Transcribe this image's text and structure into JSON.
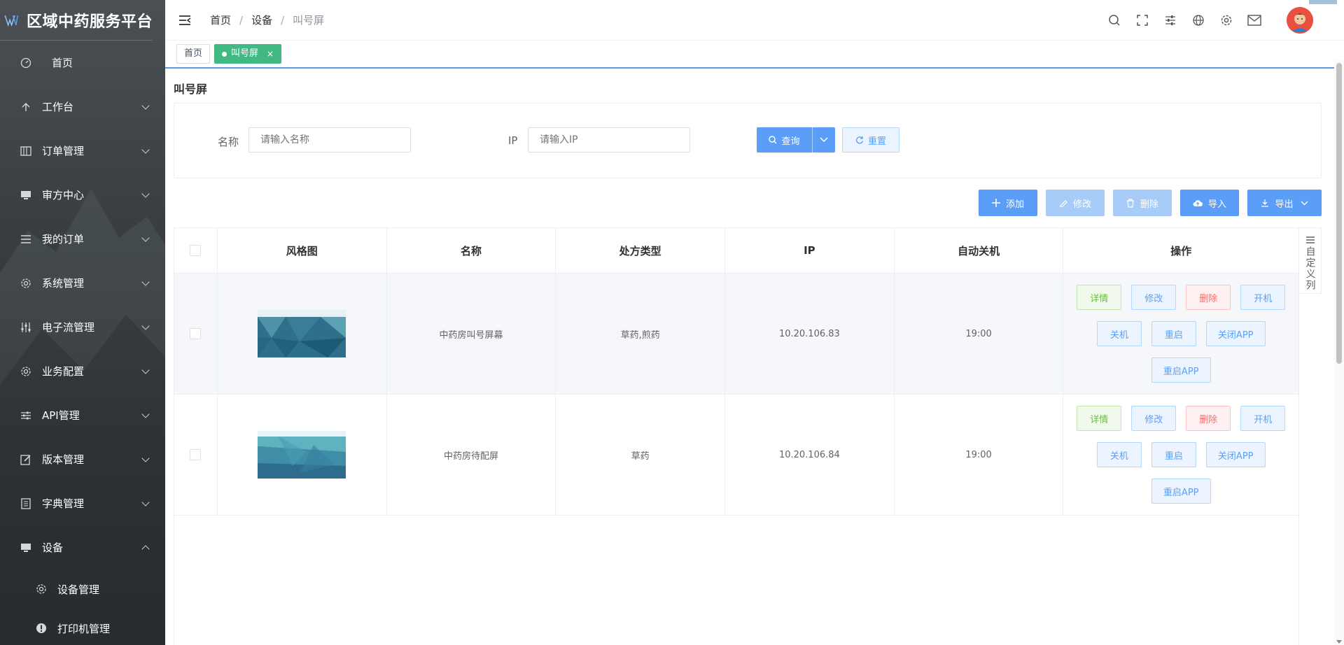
{
  "brand": {
    "title": "区域中药服务平台"
  },
  "sidebar": {
    "items": [
      {
        "label": "首页",
        "icon": "dashboard-icon",
        "has_arrow": false
      },
      {
        "label": "工作台",
        "icon": "arrow-up-icon",
        "has_arrow": true
      },
      {
        "label": "订单管理",
        "icon": "table-icon",
        "has_arrow": true
      },
      {
        "label": "审方中心",
        "icon": "monitor-icon",
        "has_arrow": true
      },
      {
        "label": "我的订单",
        "icon": "list-icon",
        "has_arrow": true
      },
      {
        "label": "系统管理",
        "icon": "gear-icon",
        "has_arrow": true
      },
      {
        "label": "电子流管理",
        "icon": "sliders-icon",
        "has_arrow": true
      },
      {
        "label": "业务配置",
        "icon": "gear-icon",
        "has_arrow": true
      },
      {
        "label": "API管理",
        "icon": "filter-icon",
        "has_arrow": true
      },
      {
        "label": "版本管理",
        "icon": "edit-icon",
        "has_arrow": true
      },
      {
        "label": "字典管理",
        "icon": "book-icon",
        "has_arrow": true
      },
      {
        "label": "设备",
        "icon": "monitor-icon",
        "has_arrow": true,
        "expanded": true
      }
    ],
    "sub_items": [
      {
        "label": "设备管理",
        "icon": "gear-icon"
      },
      {
        "label": "打印机管理",
        "icon": "info-icon"
      }
    ]
  },
  "header": {
    "breadcrumb": [
      "首页",
      "设备",
      "叫号屏"
    ],
    "sep": "/"
  },
  "tabs": [
    {
      "label": "首页",
      "active": false
    },
    {
      "label": "叫号屏",
      "active": true,
      "close": "×"
    }
  ],
  "page": {
    "title": "叫号屏"
  },
  "search": {
    "name_label": "名称",
    "name_placeholder": "请输入名称",
    "ip_label": "IP",
    "ip_placeholder": "请输入IP",
    "query_label": "查询",
    "reset_label": "重置"
  },
  "toolbar": {
    "add": "添加",
    "edit": "修改",
    "delete": "删除",
    "import": "导入",
    "export": "导出"
  },
  "table": {
    "columns": [
      "风格图",
      "名称",
      "处方类型",
      "IP",
      "自动关机",
      "操作"
    ],
    "rows": [
      {
        "name": "中药房叫号屏幕",
        "type": "草药,煎药",
        "ip": "10.20.106.83",
        "auto_off": "19:00"
      },
      {
        "name": "中药房待配屏",
        "type": "草药",
        "ip": "10.20.106.84",
        "auto_off": "19:00"
      }
    ],
    "ops": {
      "detail": "详情",
      "edit": "修改",
      "delete": "删除",
      "power_on": "开机",
      "power_off": "关机",
      "restart": "重启",
      "close_app": "关闭APP",
      "restart_app": "重启APP"
    },
    "custom_col": "自定义列"
  },
  "colors": {
    "primary": "#5b9ef8",
    "tab_active": "#42b983",
    "sidebar_bg": "#2b3034"
  }
}
